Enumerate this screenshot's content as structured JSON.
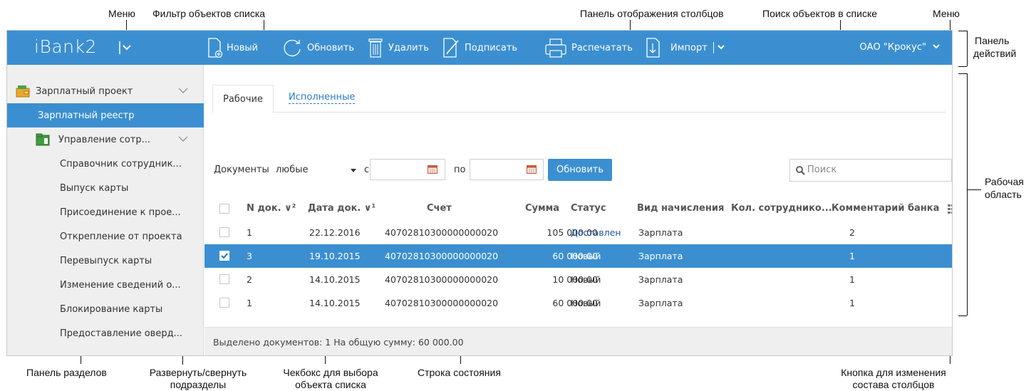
{
  "annotations": {
    "menu_left": "Меню",
    "filter": "Фильтр объектов списка",
    "columns_panel": "Панель отображения столбцов",
    "search": "Поиск объектов в списке",
    "menu_right": "Меню",
    "actions_panel": [
      "Панель",
      "действий"
    ],
    "work_area": [
      "Рабочая",
      "область"
    ],
    "sections_panel": "Панель разделов",
    "expand_collapse": [
      "Развернуть/свернуть",
      "подразделы"
    ],
    "checkbox": [
      "Чекбокс для выбора",
      "объекта списка"
    ],
    "status_line": "Строка состояния",
    "columns_button": [
      "Кнопка для изменения",
      "состава столбцов"
    ]
  },
  "topbar": {
    "logo": "iBank2",
    "buttons": {
      "new": "Новый",
      "refresh": "Обновить",
      "delete": "Удалить",
      "sign": "Подписать",
      "print": "Распечатать",
      "import": "Импорт"
    },
    "org": "ОАО \"Крокус\""
  },
  "sidebar": {
    "items": [
      {
        "label": "Зарплатный проект",
        "icon": "wallet-icon"
      },
      {
        "label": "Зарплатный реестр"
      },
      {
        "label": "Управление сотр...",
        "icon": "folder-icon"
      },
      {
        "label": "Справочник сотрудник..."
      },
      {
        "label": "Выпуск карты"
      },
      {
        "label": "Присоединение к прое..."
      },
      {
        "label": "Открепление от проекта"
      },
      {
        "label": "Перевыпуск карты"
      },
      {
        "label": "Изменение сведений о..."
      },
      {
        "label": "Блокирование карты"
      },
      {
        "label": "Предоставление оверд..."
      }
    ]
  },
  "tabs": {
    "work": "Рабочие",
    "done": "Исполненные"
  },
  "filter": {
    "docs_label": "Документы",
    "docs_value": "любые",
    "from_label": "с",
    "to_label": "по",
    "refresh": "Обновить"
  },
  "search": {
    "placeholder": "Поиск"
  },
  "table": {
    "headers": {
      "num": "N док. ∨²",
      "date": "Дата док. ∨¹",
      "account": "Счет",
      "sum": "Сумма",
      "status": "Статус",
      "type": "Вид начисления",
      "count": "Кол. сотруднико...",
      "comment": "Комментарий банка"
    },
    "rows": [
      {
        "num": "1",
        "date": "22.12.2016",
        "account": "40702810300000000020",
        "sum": "105 000.00",
        "status": "Доставлен",
        "type": "Зарплата",
        "count": "2",
        "checked": false,
        "selected": false
      },
      {
        "num": "3",
        "date": "19.10.2015",
        "account": "40702810300000000020",
        "sum": "60 000.00",
        "status": "Новый",
        "type": "Зарплата",
        "count": "1",
        "checked": true,
        "selected": true
      },
      {
        "num": "2",
        "date": "14.10.2015",
        "account": "40702810300000000020",
        "sum": "10 000.00",
        "status": "Новый",
        "type": "Зарплата",
        "count": "1",
        "checked": false,
        "selected": false
      },
      {
        "num": "1",
        "date": "14.10.2015",
        "account": "40702810300000000020",
        "sum": "60 000.00",
        "status": "Новый",
        "type": "Зарплата",
        "count": "1",
        "checked": false,
        "selected": false
      }
    ]
  },
  "statusbar": "Выделено документов: 1 На общую сумму: 60 000.00",
  "colors": {
    "accent": "#3b8fd0",
    "sidebar_bg": "#efefef",
    "status_delivered": "#2253a4"
  }
}
